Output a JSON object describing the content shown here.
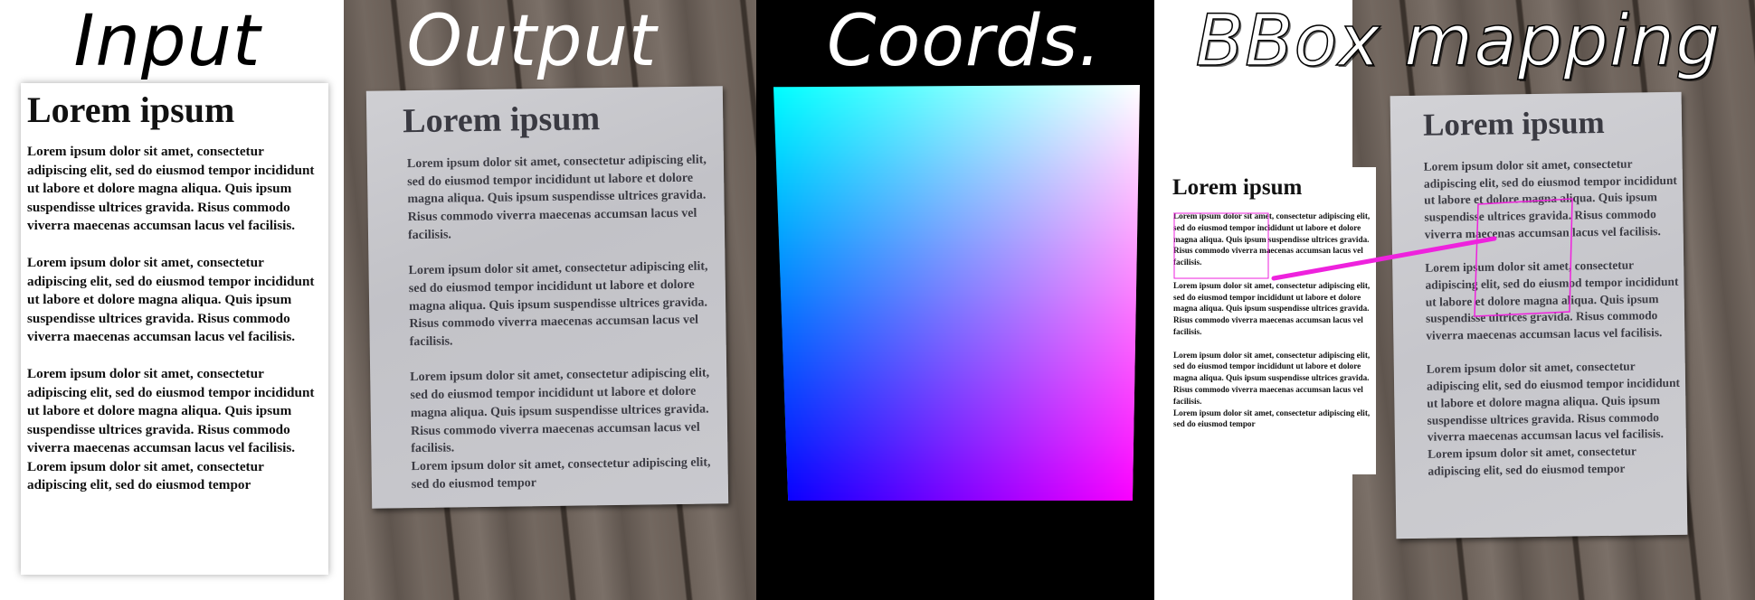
{
  "panels": {
    "input": {
      "title": "Input"
    },
    "output": {
      "title": "Output"
    },
    "coords": {
      "title": "Coords."
    },
    "bbox": {
      "title": "BBox mapping"
    }
  },
  "document": {
    "title": "Lorem ipsum",
    "paragraph": "Lorem ipsum dolor sit amet, consectetur adipiscing elit, sed do eiusmod tempor incididunt ut labore et dolore magna aliqua. Quis ipsum suspendisse ultrices gravida. Risus commodo viverra maecenas accumsan lacus vel facilisis.",
    "tail": "Lorem ipsum dolor sit amet, consectetur adipiscing elit, sed do eiusmod tempor"
  },
  "colors": {
    "bbox_highlight": "#ee22dd",
    "coords_top_left": "#00ffff",
    "coords_top_right": "#ffffff",
    "coords_bottom_left": "#0000ff",
    "coords_bottom_right": "#ff00ff"
  }
}
